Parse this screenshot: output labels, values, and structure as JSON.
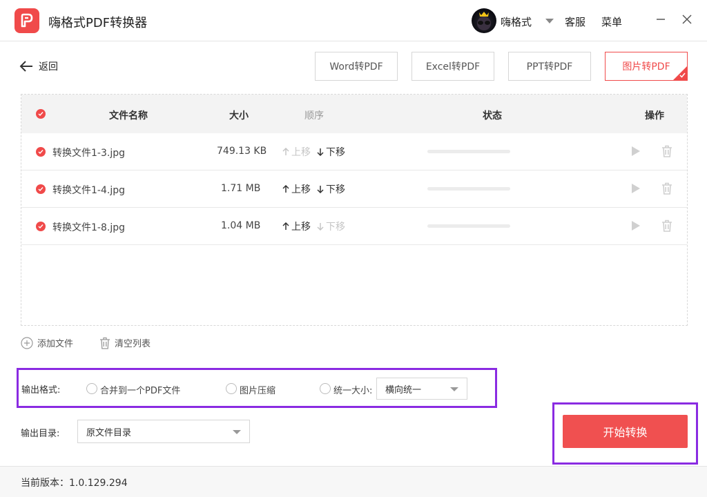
{
  "app": {
    "title": "嗨格式PDF转换器",
    "username": "嗨格式",
    "service_label": "客服",
    "menu_label": "菜单"
  },
  "nav": {
    "back_label": "返回",
    "tabs": [
      {
        "label": "Word转PDF",
        "active": false
      },
      {
        "label": "Excel转PDF",
        "active": false
      },
      {
        "label": "PPT转PDF",
        "active": false
      },
      {
        "label": "图片转PDF",
        "active": true
      }
    ]
  },
  "table": {
    "headers": {
      "name": "文件名称",
      "size": "大小",
      "order": "顺序",
      "status": "状态",
      "action": "操作"
    },
    "rows": [
      {
        "name": "转换文件1-3.jpg",
        "size": "749.13 KB",
        "up_label": "上移",
        "down_label": "下移",
        "up_enabled": false,
        "down_enabled": true,
        "progress": 0
      },
      {
        "name": "转换文件1-4.jpg",
        "size": "1.71 MB",
        "up_label": "上移",
        "down_label": "下移",
        "up_enabled": true,
        "down_enabled": true,
        "progress": 0
      },
      {
        "name": "转换文件1-8.jpg",
        "size": "1.04 MB",
        "up_label": "上移",
        "down_label": "下移",
        "up_enabled": true,
        "down_enabled": false,
        "progress": 0
      }
    ]
  },
  "actions": {
    "add_file": "添加文件",
    "clear_list": "清空列表"
  },
  "output": {
    "format_label": "输出格式:",
    "option_merge": "合并到一个PDF文件",
    "option_compress": "图片压缩",
    "option_uniform": "统一大小:",
    "uniform_value": "横向统一",
    "dir_label": "输出目录:",
    "dir_value": "原文件目录"
  },
  "start_label": "开始转换",
  "version_text": "当前版本：1.0.129.294",
  "colors": {
    "accent": "#f04a4a",
    "highlight": "#8a2be2"
  }
}
